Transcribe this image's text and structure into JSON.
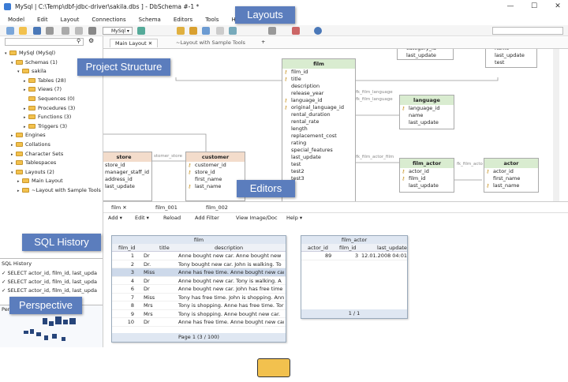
{
  "window": {
    "title": "MySql | C:\\Temp\\dbf-jdbc-driver\\sakila.dbs ] - DbSchema #-1 *"
  },
  "menu": [
    "Model",
    "Edit",
    "Layout",
    "Connections",
    "Schema",
    "Editors",
    "Tools",
    "Help"
  ],
  "toolbar": {
    "db_select": "MySql"
  },
  "tabs": {
    "main_layout": "Main Layout",
    "sample_layout": "~Layout with Sample Tools"
  },
  "callouts": {
    "layouts": "Layouts",
    "project_structure": "Project Structure",
    "editors": "Editors",
    "sql_history": "SQL History",
    "perspective": "Perspective"
  },
  "tree": [
    {
      "label": "MySql (MySql)",
      "indent": 0
    },
    {
      "label": "Schemas (1)",
      "indent": 1
    },
    {
      "label": "sakila",
      "indent": 2
    },
    {
      "label": "Tables (28)",
      "indent": 3
    },
    {
      "label": "Views (7)",
      "indent": 3
    },
    {
      "label": "Sequences (0)",
      "indent": 3
    },
    {
      "label": "Procedures (3)",
      "indent": 3
    },
    {
      "label": "Functions (3)",
      "indent": 3
    },
    {
      "label": "Triggers (3)",
      "indent": 3
    },
    {
      "label": "Engines",
      "indent": 1
    },
    {
      "label": "Collations",
      "indent": 1
    },
    {
      "label": "Character Sets",
      "indent": 1
    },
    {
      "label": "Tablespaces",
      "indent": 1
    },
    {
      "label": "Layouts (2)",
      "indent": 1
    },
    {
      "label": "Main Layout",
      "indent": 2
    },
    {
      "label": "~Layout with Sample Tools",
      "indent": 2
    }
  ],
  "film_entity": {
    "name": "film",
    "columns": [
      "film_id",
      "title",
      "description",
      "release_year",
      "language_id",
      "original_language_id",
      "rental_duration",
      "rental_rate",
      "length",
      "replacement_cost",
      "rating",
      "special_features",
      "last_update",
      "test",
      "test2",
      "test3"
    ]
  },
  "language_entity": {
    "name": "language",
    "columns": [
      "language_id",
      "name",
      "last_update"
    ]
  },
  "film_actor_entity": {
    "name": "film_actor",
    "columns": [
      "actor_id",
      "film_id",
      "last_update"
    ]
  },
  "actor_entity": {
    "name": "actor",
    "columns": [
      "actor_id",
      "first_name",
      "last_name"
    ]
  },
  "store_entity": {
    "name": "store",
    "columns": [
      "store_id",
      "manager_staff_id",
      "address_id",
      "last_update"
    ]
  },
  "customer_entity": {
    "name": "customer",
    "columns": [
      "customer_id",
      "store_id",
      "first_name",
      "last_name"
    ]
  },
  "category_entity": {
    "columns": [
      "category_id",
      "last_update"
    ]
  },
  "top_right_entity": {
    "columns": [
      "name",
      "last_update",
      "test"
    ]
  },
  "links": {
    "film_language": "fk_film_language",
    "film_language2": "fk_film_language",
    "film_actor_film": "fk_film_actor_film",
    "film_actor": "fk_film_acto",
    "store_customer": "stomer_store"
  },
  "editor_tabs": [
    "film",
    "film_001",
    "film_002"
  ],
  "editor_toolbar": {
    "add": "Add",
    "edit": "Edit",
    "reload": "Reload",
    "add_filter": "Add Filter",
    "view_image": "View Image/Doc",
    "help": "Help"
  },
  "film_grid": {
    "title": "film",
    "headers": [
      "film_id",
      "title",
      "description"
    ],
    "rows": [
      [
        "1",
        "Dr",
        "Anne bought new car. Anne bought new"
      ],
      [
        "2",
        "Dr.",
        "Tony bought new car. John is walking. To"
      ],
      [
        "3",
        "Miss",
        "Anne has free time. Anne bought new car"
      ],
      [
        "4",
        "Dr",
        "Anne bought new car. Tony is walking. A"
      ],
      [
        "6",
        "Dr",
        "Anne bought new car. John has free time"
      ],
      [
        "7",
        "Miss",
        "Tony has free time. John is shopping. Ann"
      ],
      [
        "8",
        "Mrs",
        "Tony is shopping. Anne has free time. Tor"
      ],
      [
        "9",
        "Mrs",
        "Tony is shopping. Anne bought new car."
      ],
      [
        "10",
        "Dr",
        "Anne has free time. Anne bought new car"
      ]
    ],
    "pager": "Page 1 (3 / 100)"
  },
  "film_actor_grid": {
    "title": "film_actor",
    "headers": [
      "actor_id",
      "film_id",
      "last_update"
    ],
    "rows": [
      [
        "89",
        "3",
        "12.01.2008 04:01"
      ]
    ],
    "pager": "1 / 1"
  },
  "sql_history": {
    "title": "SQL History",
    "items": [
      "SELECT actor_id, film_id, last_upda",
      "SELECT actor_id, film_id, last_upda",
      "SELECT actor_id, film_id, last_upda"
    ]
  },
  "perspective_label": "Perspective",
  "colors": {
    "callout": "#5b7dbd",
    "entity_green": "#d9ecd0",
    "entity_orange": "#f3dccb"
  }
}
